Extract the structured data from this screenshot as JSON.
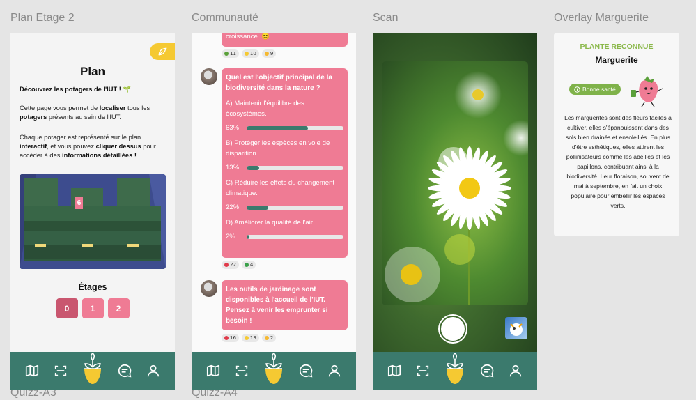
{
  "frames": {
    "plan": "Plan Etage 2",
    "communaute": "Communauté",
    "scan": "Scan",
    "overlay": "Overlay Marguerite",
    "quizz_a3": "Quizz-A3",
    "quizz_a4": "Quizz-A4"
  },
  "colors": {
    "accent": "#ef7b94",
    "accent_dark": "#c9566f",
    "nav": "#3b7a6d",
    "yellow": "#f5c932",
    "green": "#7fb24a"
  },
  "plan": {
    "badge_icon": "leaf-icon",
    "title": "Plan",
    "intro_bold": "Découvrez les potagers de l'IUT !",
    "p1_a": "Cette page vous permet de ",
    "p1_b": "localiser",
    "p1_c": " tous les ",
    "p1_d": "potagers",
    "p1_e": " présents au sein de l'IUT.",
    "p2_a": "Chaque potager est représenté sur le plan ",
    "p2_b": "interactif",
    "p2_c": ", et vous pouvez ",
    "p2_d": "cliquer dessus",
    "p2_e": " pour accéder à des ",
    "p2_f": "informations détaillées !",
    "map_marker": "6",
    "etages_title": "Étages",
    "etages": [
      "0",
      "1",
      "2"
    ]
  },
  "comm": {
    "top_text": "croissance. 😊",
    "top_reacts": [
      "11",
      "10",
      "9"
    ],
    "poll": {
      "question": "Quel est l'objectif principal de la biodiversité dans la nature ?",
      "options": [
        {
          "label": "A) Maintenir l'équilibre des écosystèmes.",
          "pct": "63%",
          "value": 63
        },
        {
          "label": "B) Protéger les espèces en voie de disparition.",
          "pct": "13%",
          "value": 13
        },
        {
          "label": "C) Réduire les effets du changement climatique.",
          "pct": "22%",
          "value": 22
        },
        {
          "label": "D) Améliorer la qualité de l'air.",
          "pct": "2%",
          "value": 2
        }
      ],
      "reacts": [
        "22",
        "4"
      ]
    },
    "message": "Les outils de jardinage sont disponibles à l'accueil de l'IUT. Pensez à venir les emprunter si besoin !",
    "message_reacts": [
      "16",
      "13",
      "2"
    ]
  },
  "overlay": {
    "title": "PLANTE RECONNUE",
    "name": "Marguerite",
    "health": "Bonne santé",
    "description": "Les marguerites sont des fleurs faciles à cultiver, elles s'épanouissent dans des sols bien drainés et ensoleillés. En plus d'être esthétiques, elles attirent les pollinisateurs comme les abeilles et les papillons, contribuant ainsi à la biodiversité. Leur floraison, souvent de mai à septembre, en fait un choix populaire pour embellir les espaces verts."
  },
  "nav_icons": [
    "map-icon",
    "scan-icon",
    "plant-home-icon",
    "chat-icon",
    "user-icon"
  ]
}
